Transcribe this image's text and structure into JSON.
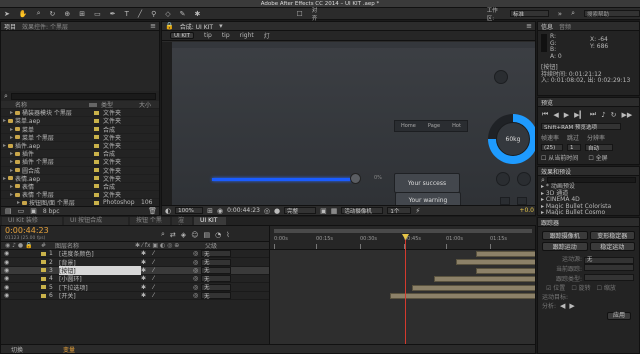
{
  "title_bar": {
    "text": "Adobe After Effects CC 2014 – UI KIT .aep *"
  },
  "toolbar": {
    "align_label": "对齐",
    "workspace_label": "工作区:",
    "workspace_value": "标准",
    "search_placeholder": "搜索帮助"
  },
  "project": {
    "tab": "项目",
    "tab2": "效果控件: 个黑层",
    "search_icon": "search-icon",
    "columns": {
      "name": "名称",
      "type": "类型",
      "size": "大小"
    },
    "items": [
      {
        "name": "桶装器模块 个黑层",
        "type": "文件夹",
        "size": "",
        "indent": 2
      },
      {
        "name": "菜单.aep",
        "type": "文件夹",
        "size": "",
        "indent": 1
      },
      {
        "name": "菜单",
        "type": "合成",
        "size": "",
        "indent": 2
      },
      {
        "name": "菜单 个黑层",
        "type": "文件夹",
        "size": "",
        "indent": 2
      },
      {
        "name": "插件.aep",
        "type": "文件夹",
        "size": "",
        "indent": 1
      },
      {
        "name": "插件",
        "type": "合成",
        "size": "",
        "indent": 2
      },
      {
        "name": "插件 个黑层",
        "type": "文件夹",
        "size": "",
        "indent": 2
      },
      {
        "name": "圆合成",
        "type": "文件夹",
        "size": "",
        "indent": 2
      },
      {
        "name": "表情.aep",
        "type": "文件夹",
        "size": "",
        "indent": 1
      },
      {
        "name": "表情",
        "type": "合成",
        "size": "",
        "indent": 2
      },
      {
        "name": "表情 个黑层",
        "type": "文件夹",
        "size": "",
        "indent": 2
      },
      {
        "name": "按钮图/面 个黑层",
        "type": "Photoshop",
        "size": "106",
        "indent": 3
      },
      {
        "name": "按钮/面 个黑层",
        "type": "Photoshop",
        "size": "106",
        "indent": 3
      }
    ],
    "bpc": "8 bpc"
  },
  "composition": {
    "tab": "合成: UI KIT",
    "breadcrumbs": [
      "UI KIT",
      "tip",
      "tip",
      "right",
      "灯"
    ],
    "zoom": "100%",
    "timecode": "0:00:44:23",
    "quality": "完整",
    "camera": "活动摄像机",
    "views": "1个",
    "offset": "+0.0",
    "nav_items": [
      "Home",
      "Page",
      "Hot"
    ],
    "knob_value": "60kg",
    "slider_value": "0%",
    "success_label": "Your success",
    "warning_label": "Your warning"
  },
  "info": {
    "tab": "信息",
    "tab2": "音频",
    "r": "R:",
    "g": "G:",
    "b": "B:",
    "a": "A: 0",
    "x": "X: -64",
    "y": "Y: 686",
    "layer_name": "[按钮]",
    "duration": "持续时间: 0:01:21:12",
    "in": "入: 0:01:08:02,",
    "out": "出: 0:02:29:13"
  },
  "preview": {
    "tab": "预览",
    "ram": "Shift+RAM 预览选项",
    "frame_rate_label": "帧速率",
    "skip_label": "跳过",
    "resolution_label": "分辨率",
    "frame_rate": "(25)",
    "skip": "1",
    "resolution": "自动",
    "from_current": "从当前时间",
    "full_screen": "全屏"
  },
  "effects": {
    "tab": "效果和预设",
    "items": [
      "* 动画预设",
      "3D 通道",
      "CINEMA 4D",
      "Magic Bullet Colorista",
      "Magic Bullet Cosmo"
    ]
  },
  "tracker": {
    "tab": "跟踪器",
    "buttons": [
      "跟踪摄像机",
      "变形稳定器",
      "跟踪运动",
      "稳定运动"
    ],
    "motion_source": "运动源:",
    "motion_value": "无",
    "current_track": "当前跟踪:",
    "track_type": "跟踪类型:",
    "options": [
      "位置",
      "旋转",
      "缩放"
    ],
    "motion_target": "运动目标:",
    "analyze": "分析:",
    "apply": "应用"
  },
  "timeline": {
    "tabs": [
      "UI Kit 装修",
      "UI 按钮合成",
      "按钮 个黑层",
      "渲染",
      "UI KIT"
    ],
    "timecode": "0:00:44:23",
    "sub_timecode": "01123 (25.00 fps)",
    "col_layer": "图层名称",
    "col_parent": "父级",
    "ruler_labels": [
      "0:00s",
      "00:15s",
      "00:30s",
      "00:45s",
      "01:00s",
      "01:15s"
    ],
    "layers": [
      {
        "num": "1",
        "name": "[进度条颜色]",
        "parent": "无"
      },
      {
        "num": "2",
        "name": "[背景]",
        "parent": "无"
      },
      {
        "num": "3",
        "name": "[按钮]",
        "parent": "无"
      },
      {
        "num": "4",
        "name": "[小圆环]",
        "parent": "无"
      },
      {
        "num": "5",
        "name": "[下拉选项]",
        "parent": "无"
      },
      {
        "num": "6",
        "name": "[开关]",
        "parent": "无"
      }
    ],
    "bottom_labels": [
      "切换",
      "变量"
    ]
  }
}
